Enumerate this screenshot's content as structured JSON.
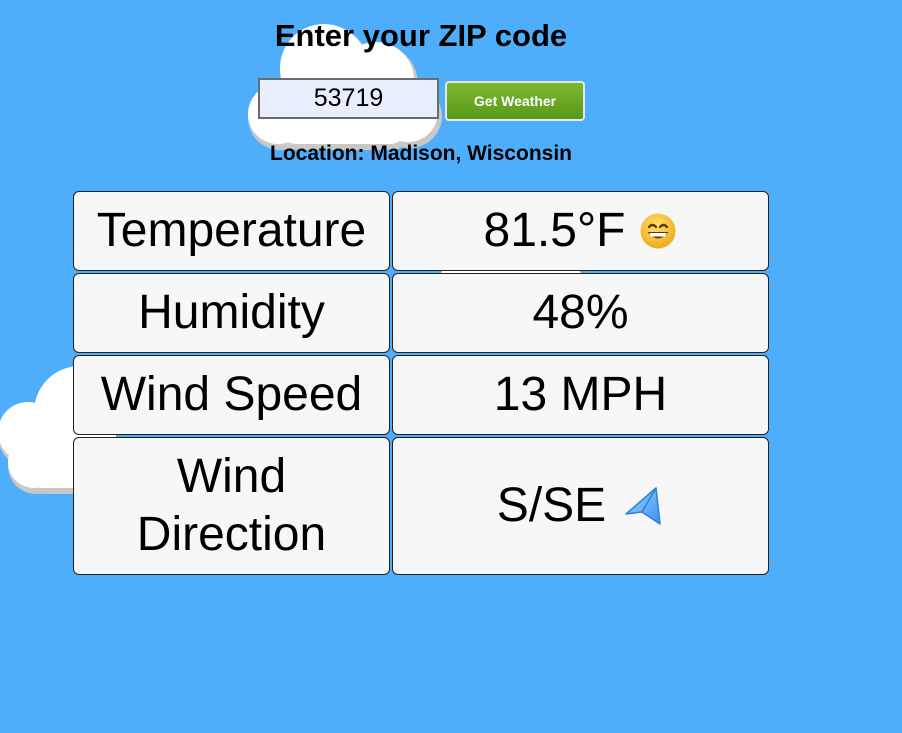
{
  "header": {
    "title": "Enter your ZIP code"
  },
  "search": {
    "zip_value": "53719",
    "button_label": "Get Weather"
  },
  "location": {
    "text": "Location: Madison, Wisconsin"
  },
  "weather": {
    "rows": [
      {
        "label": "Temperature",
        "value": "81.5°F",
        "icon": "grinning-face-icon"
      },
      {
        "label": "Humidity",
        "value": "48%"
      },
      {
        "label": "Wind Speed",
        "value": "13 MPH"
      },
      {
        "label": "Wind Direction",
        "value": "S/SE",
        "icon": "paper-plane-direction-icon"
      }
    ]
  },
  "colors": {
    "background": "#4faefb",
    "button": "#6aa922",
    "cell_background": "#f7f7f7",
    "input_background": "#e8eefc"
  }
}
